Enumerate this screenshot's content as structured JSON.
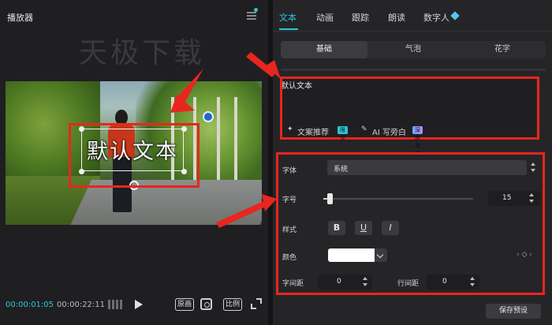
{
  "player": {
    "title": "播放器",
    "watermark": "天极下载",
    "video_text": "默认文本",
    "time_current": "00:00:01:05",
    "time_total": "00:00:22:11",
    "btn_original": "原画",
    "btn_ratio": "比例"
  },
  "tabs": [
    {
      "label": "文本",
      "active": true
    },
    {
      "label": "动画",
      "active": false
    },
    {
      "label": "跟踪",
      "active": false
    },
    {
      "label": "朗读",
      "active": false
    },
    {
      "label": "数字人",
      "active": false
    }
  ],
  "subtabs": [
    {
      "label": "基础",
      "active": true
    },
    {
      "label": "气泡",
      "active": false
    },
    {
      "label": "花字",
      "active": false
    }
  ],
  "text_input": {
    "value": "默认文本",
    "copy_recommend": "文案推荐",
    "copy_badge": "限免",
    "ai_write": "AI 写旁白",
    "ai_badge": "深度思考"
  },
  "properties": {
    "font_label": "字体",
    "font_value": "系统",
    "size_label": "字号",
    "size_value": "15",
    "size_fraction": 0.04,
    "style_label": "样式",
    "style_bold": "B",
    "style_underline": "U",
    "style_italic": "I",
    "color_label": "颜色",
    "color_value": "#ffffff",
    "letter_spacing_label": "字间距",
    "letter_spacing_value": "0",
    "line_spacing_label": "行间距",
    "line_spacing_value": "0"
  },
  "save_preset": "保存预设",
  "colors": {
    "accent": "#2cc6d6",
    "annotation_red": "#e8261f",
    "panel_bg": "#252528"
  }
}
